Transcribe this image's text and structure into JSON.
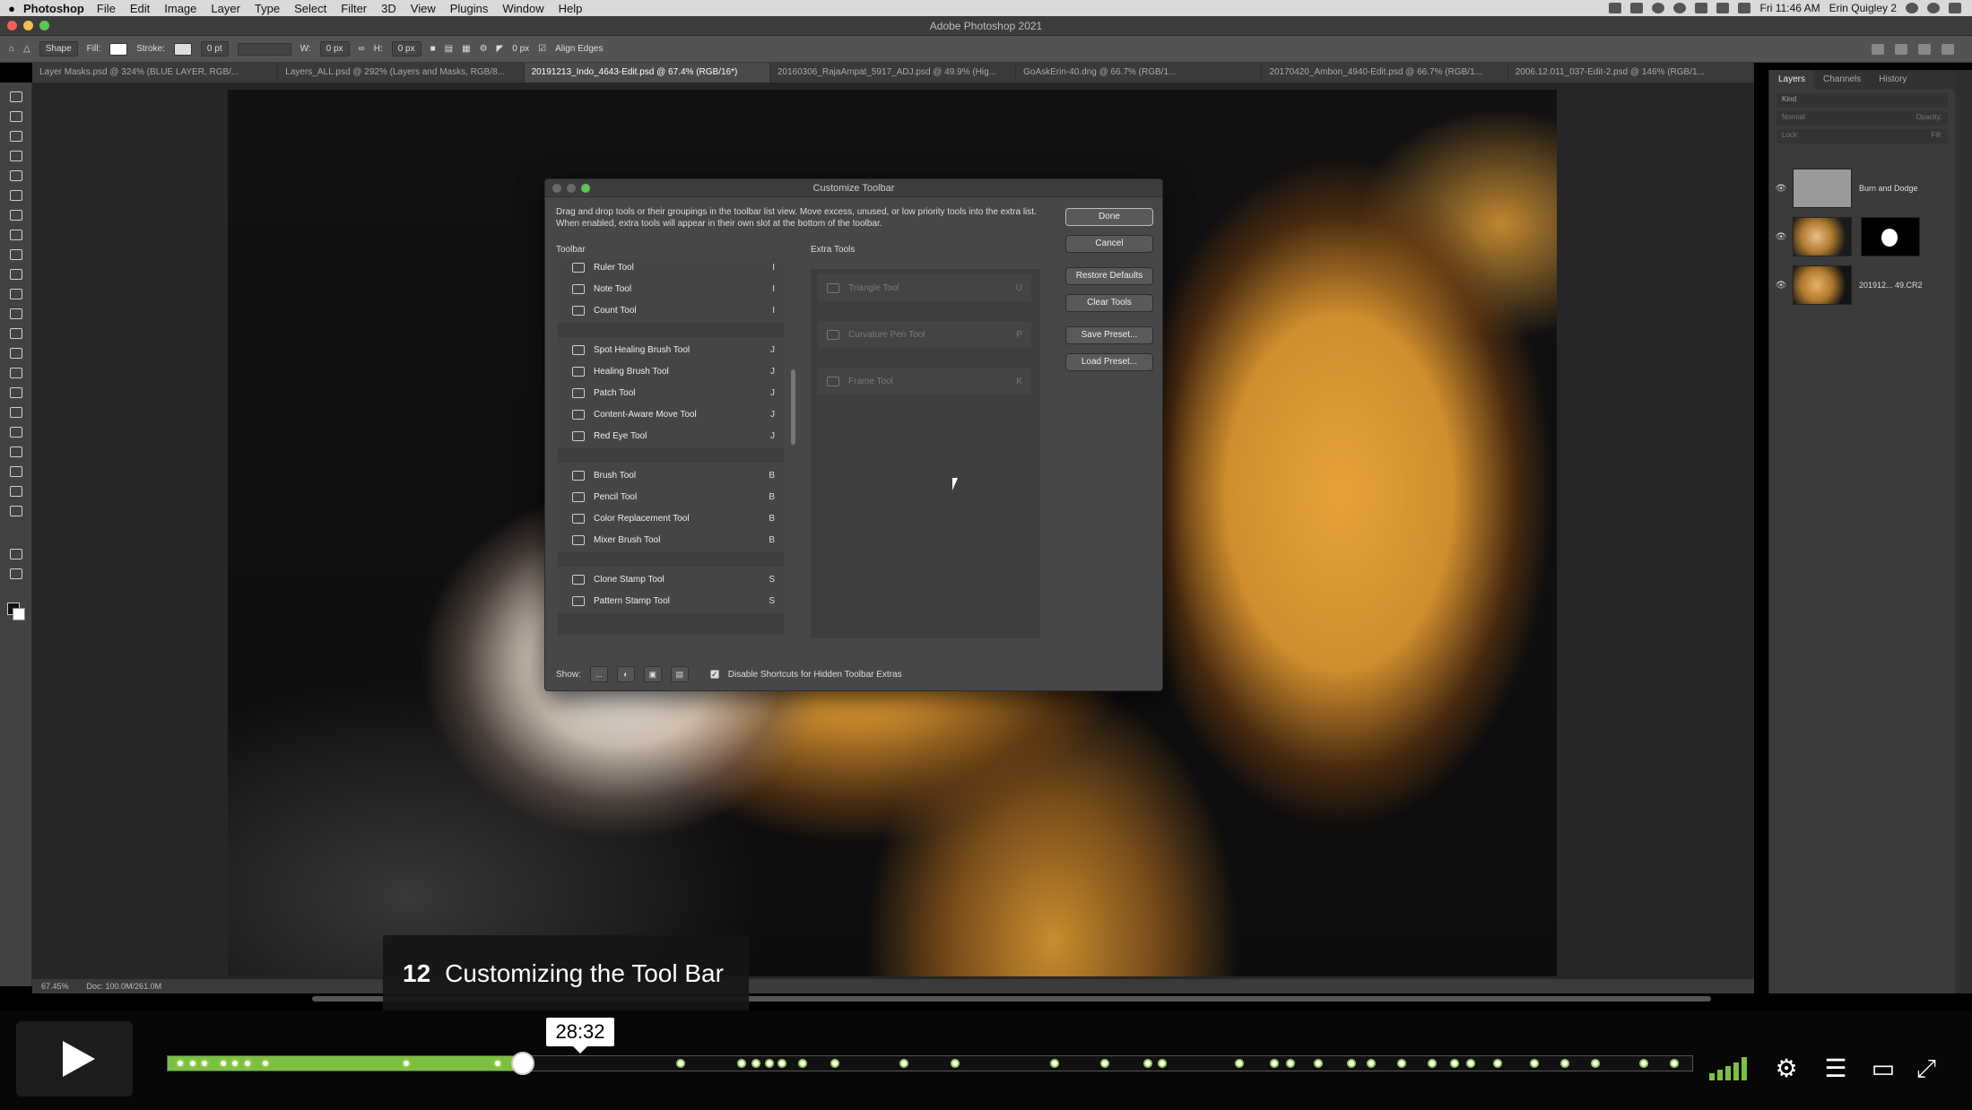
{
  "menubar": {
    "app": "Photoshop",
    "items": [
      "File",
      "Edit",
      "Image",
      "Layer",
      "Type",
      "Select",
      "Filter",
      "3D",
      "View",
      "Plugins",
      "Window",
      "Help"
    ],
    "clock": "Fri 11:46 AM",
    "user": "Erin Quigley 2"
  },
  "window": {
    "title": "Adobe Photoshop 2021"
  },
  "options": {
    "tool": "Shape",
    "fill": "Fill:",
    "stroke": "Stroke:",
    "stroke_width": "0 pt",
    "w_label": "W:",
    "w_value": "0 px",
    "h_label": "H:",
    "h_value": "0 px",
    "radius": "0 px",
    "align_edges": "Align Edges"
  },
  "tabs": [
    "Layer Masks.psd @ 324% (BLUE LAYER, RGB/...",
    "Layers_ALL.psd @ 292% (Layers and Masks, RGB/8...",
    "20191213_Indo_4643-Edit.psd @ 67.4% (RGB/16*)",
    "20160306_RajaAmpat_5917_ADJ.psd @ 49.9% (Hig...",
    "GoAskErin-40.dng @ 66.7% (RGB/1...",
    "20170420_Ambon_4940-Edit.psd @ 66.7% (RGB/1...",
    "2006.12.011_037-Edit-2.psd @ 146% (RGB/1..."
  ],
  "active_tab": 2,
  "status": {
    "zoom": "67.45%",
    "doc": "Doc: 100.0M/261.0M"
  },
  "panel": {
    "tabs": [
      "Layers",
      "Channels",
      "History"
    ],
    "kind": "Kind",
    "mode": "Normal",
    "opacity_label": "Opacity:",
    "lock_label": "Lock:",
    "fill_label": "Fill:",
    "layers": [
      {
        "name": "Burn and Dodge"
      },
      {
        "name": ""
      },
      {
        "name": "201912... 49.CR2"
      }
    ]
  },
  "dialog": {
    "title": "Customize Toolbar",
    "description": "Drag and drop tools or their groupings in the toolbar list view. Move excess, unused, or low priority tools into the extra list. When enabled, extra tools will appear in their own slot at the bottom of the toolbar.",
    "toolbar_header": "Toolbar",
    "extra_header": "Extra Tools",
    "groups": [
      [
        {
          "name": "Ruler Tool",
          "key": "I"
        },
        {
          "name": "Note Tool",
          "key": "I"
        },
        {
          "name": "Count Tool",
          "key": "I"
        }
      ],
      [
        {
          "name": "Spot Healing Brush Tool",
          "key": "J"
        },
        {
          "name": "Healing Brush Tool",
          "key": "J"
        },
        {
          "name": "Patch Tool",
          "key": "J"
        },
        {
          "name": "Content-Aware Move Tool",
          "key": "J"
        },
        {
          "name": "Red Eye Tool",
          "key": "J"
        }
      ],
      [
        {
          "name": "Brush Tool",
          "key": "B"
        },
        {
          "name": "Pencil Tool",
          "key": "B"
        },
        {
          "name": "Color Replacement Tool",
          "key": "B"
        },
        {
          "name": "Mixer Brush Tool",
          "key": "B"
        }
      ],
      [
        {
          "name": "Clone Stamp Tool",
          "key": "S"
        },
        {
          "name": "Pattern Stamp Tool",
          "key": "S"
        }
      ]
    ],
    "extras": [
      {
        "name": "Triangle Tool",
        "key": "U"
      },
      {
        "name": "Curvature Pen Tool",
        "key": "P"
      },
      {
        "name": "Frame Tool",
        "key": "K"
      }
    ],
    "buttons": {
      "done": "Done",
      "cancel": "Cancel",
      "restore": "Restore Defaults",
      "clear": "Clear Tools",
      "save": "Save Preset...",
      "load": "Load Preset..."
    },
    "show_label": "Show:",
    "show_dots": "...",
    "disable_shortcuts": "Disable Shortcuts for Hidden Toolbar Extras"
  },
  "player": {
    "chapter_number": "12",
    "chapter_title": "Customizing the Tool Bar",
    "time_tooltip": "28:32",
    "progress": 0.233,
    "accent": "#7bc040"
  }
}
